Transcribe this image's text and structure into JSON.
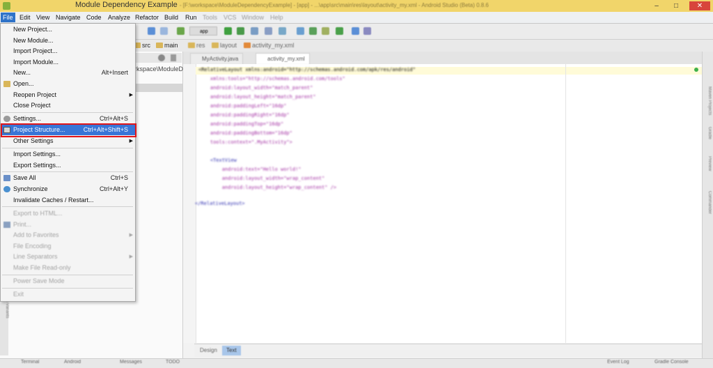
{
  "window": {
    "title": "Module Dependency Example",
    "title_path": "- [F:\\workspace\\ModuleDependencyExample] - [app] - ...\\app\\src\\main\\res\\layout\\activity_my.xml - Android Studio (Beta) 0.8.6",
    "minimize": "–",
    "maximize": "□",
    "close": "✕"
  },
  "menubar": [
    "File",
    "Edit",
    "View",
    "Navigate",
    "Code",
    "Analyze",
    "Refactor",
    "Build",
    "Run",
    "Tools",
    "VCS",
    "Window",
    "Help"
  ],
  "toolbar": {
    "run_config": "app"
  },
  "navbar": {
    "crumbs": [
      "src",
      "main",
      "res",
      "layout",
      "activity_my.xml"
    ]
  },
  "project_pane": {
    "path_fragment": "rkspace\\ModuleD"
  },
  "editor": {
    "tabs": [
      "MyActivity.java",
      "activity_my.xml"
    ],
    "design_tabs": [
      "Design",
      "Text"
    ]
  },
  "right_tools": [
    "Maven Projects",
    "Gradle",
    "Preview",
    "Commander"
  ],
  "left_tools": [
    "Build Variants"
  ],
  "status_bar": [
    "Terminal",
    "Android",
    "Messages",
    "TODO",
    "Event Log",
    "Gradle Console"
  ],
  "file_menu": {
    "items": [
      {
        "label": "New Project...",
        "shortcut": ""
      },
      {
        "label": "New Module...",
        "shortcut": ""
      },
      {
        "label": "Import Project...",
        "shortcut": ""
      },
      {
        "label": "Import Module...",
        "shortcut": ""
      },
      {
        "label": "New...",
        "shortcut": "Alt+Insert"
      },
      {
        "label": "Open...",
        "shortcut": ""
      },
      {
        "label": "Reopen Project",
        "shortcut": ""
      },
      {
        "label": "Close Project",
        "shortcut": ""
      },
      {
        "label": "Settings...",
        "shortcut": "Ctrl+Alt+S"
      },
      {
        "label": "Project Structure...",
        "shortcut": "Ctrl+Alt+Shift+S"
      },
      {
        "label": "Other Settings",
        "shortcut": ""
      },
      {
        "label": "Import Settings...",
        "shortcut": ""
      },
      {
        "label": "Export Settings...",
        "shortcut": ""
      },
      {
        "label": "Save All",
        "shortcut": "Ctrl+S"
      },
      {
        "label": "Synchronize",
        "shortcut": "Ctrl+Alt+Y"
      },
      {
        "label": "Invalidate Caches / Restart...",
        "shortcut": ""
      },
      {
        "label": "Export to HTML...",
        "shortcut": ""
      },
      {
        "label": "Print...",
        "shortcut": ""
      },
      {
        "label": "Add to Favorites",
        "shortcut": ""
      },
      {
        "label": "File Encoding",
        "shortcut": ""
      },
      {
        "label": "Line Separators",
        "shortcut": ""
      },
      {
        "label": "Make File Read-only",
        "shortcut": ""
      },
      {
        "label": "Power Save Mode",
        "shortcut": ""
      },
      {
        "label": "Exit",
        "shortcut": ""
      }
    ]
  },
  "code_lines": [
    "<RelativeLayout xmlns:android=\"http://schemas.android.com/apk/res/android\"",
    "    xmlns:tools=\"http://schemas.android.com/tools\"",
    "    android:layout_width=\"match_parent\"",
    "    android:layout_height=\"match_parent\"",
    "    android:paddingLeft=\"16dp\"",
    "    android:paddingRight=\"16dp\"",
    "    android:paddingTop=\"16dp\"",
    "    android:paddingBottom=\"16dp\"",
    "    tools:context=\".MyActivity\">",
    "",
    "    <TextView",
    "        android:text=\"Hello world!\"",
    "        android:layout_width=\"wrap_content\"",
    "        android:layout_height=\"wrap_content\" />",
    "",
    "</RelativeLayout>"
  ],
  "colors": {
    "title_bar": "#f1d56a",
    "menu_active": "#2f73c9",
    "menu_highlight": "#3875d7",
    "annotation_box": "#e0151a"
  }
}
